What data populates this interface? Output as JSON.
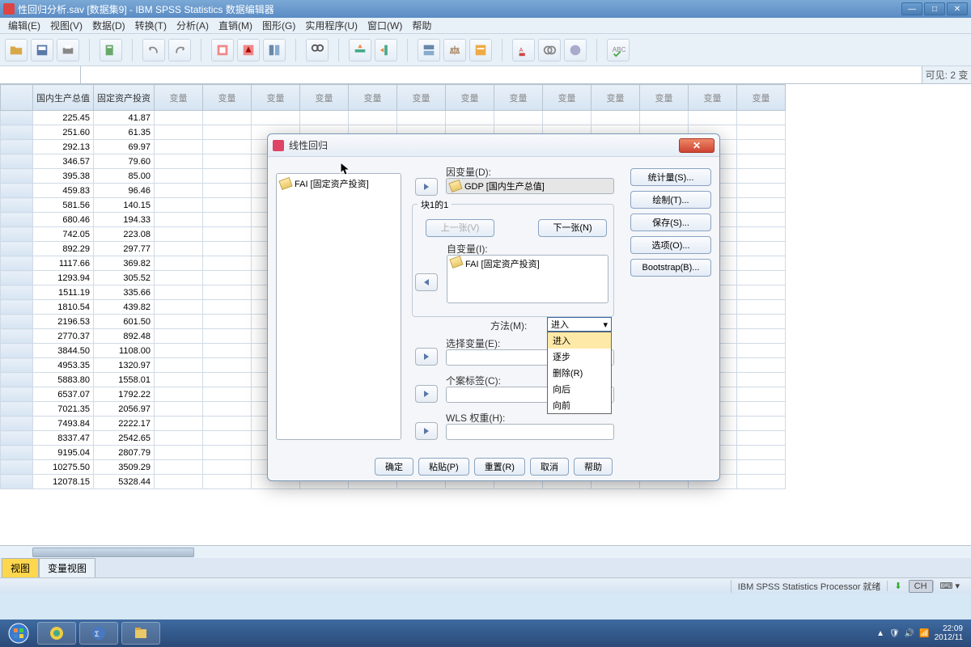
{
  "window": {
    "title": "性回归分析.sav [数据集9] - IBM SPSS Statistics 数据编辑器",
    "visible_vars_label": "可见: 2 变"
  },
  "menu": [
    "编辑(E)",
    "视图(V)",
    "数据(D)",
    "转换(T)",
    "分析(A)",
    "直销(M)",
    "图形(G)",
    "实用程序(U)",
    "窗口(W)",
    "帮助"
  ],
  "columns": [
    "国内生产总值",
    "固定资产投资",
    "变量",
    "变量",
    "变量",
    "变量",
    "变量",
    "变量",
    "变量",
    "变量",
    "变量",
    "变量",
    "变量",
    "变量",
    "变量"
  ],
  "data_rows": [
    {
      "gdp": "225.45",
      "fai": "41.87"
    },
    {
      "gdp": "251.60",
      "fai": "61.35"
    },
    {
      "gdp": "292.13",
      "fai": "69.97"
    },
    {
      "gdp": "346.57",
      "fai": "79.60"
    },
    {
      "gdp": "395.38",
      "fai": "85.00"
    },
    {
      "gdp": "459.83",
      "fai": "96.46"
    },
    {
      "gdp": "581.56",
      "fai": "140.15"
    },
    {
      "gdp": "680.46",
      "fai": "194.33"
    },
    {
      "gdp": "742.05",
      "fai": "223.08"
    },
    {
      "gdp": "892.29",
      "fai": "297.77"
    },
    {
      "gdp": "1117.66",
      "fai": "369.82"
    },
    {
      "gdp": "1293.94",
      "fai": "305.52"
    },
    {
      "gdp": "1511.19",
      "fai": "335.66"
    },
    {
      "gdp": "1810.54",
      "fai": "439.82"
    },
    {
      "gdp": "2196.53",
      "fai": "601.50"
    },
    {
      "gdp": "2770.37",
      "fai": "892.48"
    },
    {
      "gdp": "3844.50",
      "fai": "1108.00"
    },
    {
      "gdp": "4953.35",
      "fai": "1320.97"
    },
    {
      "gdp": "5883.80",
      "fai": "1558.01"
    },
    {
      "gdp": "6537.07",
      "fai": "1792.22"
    },
    {
      "gdp": "7021.35",
      "fai": "2056.97"
    },
    {
      "gdp": "7493.84",
      "fai": "2222.17"
    },
    {
      "gdp": "8337.47",
      "fai": "2542.65"
    },
    {
      "gdp": "9195.04",
      "fai": "2807.79"
    },
    {
      "gdp": "10275.50",
      "fai": "3509.29"
    },
    {
      "gdp": "12078.15",
      "fai": "5328.44"
    }
  ],
  "view_tabs": {
    "data": "视图",
    "var": "变量视图"
  },
  "status": {
    "processor": "IBM SPSS Statistics Processor 就绪",
    "ime": "CH"
  },
  "dialog": {
    "title": "线性回归",
    "var_list_item": "FAI [固定资产投资]",
    "dependent_label": "因变量(D):",
    "dependent_value": "GDP [国内生产总值]",
    "block_legend": "块1的1",
    "prev_btn": "上一张(V)",
    "next_btn": "下一张(N)",
    "independent_label": "自变量(I):",
    "independent_value": "FAI [固定资产投资]",
    "method_label": "方法(M):",
    "method_value": "进入",
    "method_options": [
      "进入",
      "逐步",
      "删除(R)",
      "向后",
      "向前"
    ],
    "select_label": "选择变量(E):",
    "case_label": "个案标签(C):",
    "wls_label": "WLS 权重(H):",
    "right_buttons": [
      "统计量(S)...",
      "绘制(T)...",
      "保存(S)...",
      "选项(O)...",
      "Bootstrap(B)..."
    ],
    "footer_buttons": [
      "确定",
      "粘贴(P)",
      "重置(R)",
      "取消",
      "帮助"
    ]
  },
  "taskbar": {
    "clock": "22:09",
    "date": "2012/11"
  }
}
